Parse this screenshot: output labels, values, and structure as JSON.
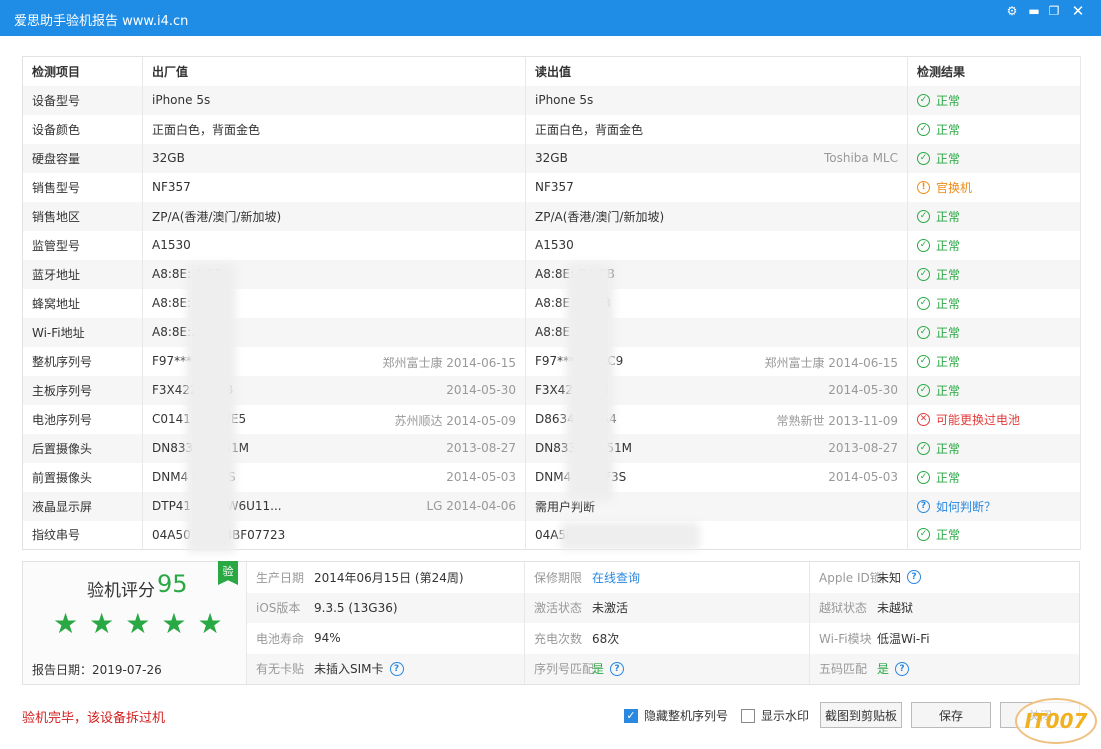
{
  "window": {
    "title": "爱思助手验机报告 www.i4.cn",
    "controls": [
      "settings-icon",
      "minimize-icon",
      "restore-icon",
      "close-icon"
    ]
  },
  "table": {
    "headers": [
      "检测项目",
      "出厂值",
      "读出值",
      "检测结果"
    ],
    "rows": [
      {
        "item": "设备型号",
        "factory": "iPhone 5s",
        "factory_note": "",
        "read": "iPhone 5s",
        "read_note": "",
        "result": "正常",
        "status": "ok"
      },
      {
        "item": "设备颜色",
        "factory": "正面白色，背面金色",
        "factory_note": "",
        "read": "正面白色，背面金色",
        "read_note": "",
        "result": "正常",
        "status": "ok"
      },
      {
        "item": "硬盘容量",
        "factory": "32GB",
        "factory_note": "",
        "read": "32GB",
        "read_note": "Toshiba MLC",
        "result": "正常",
        "status": "ok"
      },
      {
        "item": "销售型号",
        "factory": "NF357",
        "factory_note": "",
        "read": "NF357",
        "read_note": "",
        "result": "官换机",
        "status": "warn"
      },
      {
        "item": "销售地区",
        "factory": "ZP/A(香港/澳门/新加坡)",
        "factory_note": "",
        "read": "ZP/A(香港/澳门/新加坡)",
        "read_note": "",
        "result": "正常",
        "status": "ok"
      },
      {
        "item": "监管型号",
        "factory": "A1530",
        "factory_note": "",
        "read": "A1530",
        "read_note": "",
        "result": "正常",
        "status": "ok"
      },
      {
        "item": "蓝牙地址",
        "factory": "A8:8E:          A:9B",
        "factory_note": "",
        "read": "A8:8E:          DA:9B",
        "read_note": "",
        "result": "正常",
        "status": "ok"
      },
      {
        "item": "蜂窝地址",
        "factory": "A8:8E:           3B",
        "factory_note": "",
        "read": "A8:8E           DA:3B",
        "read_note": "",
        "result": "正常",
        "status": "ok"
      },
      {
        "item": "Wi-Fi地址",
        "factory": "A8:8E:2          9A",
        "factory_note": "",
        "read": "A8:8E           D:9A",
        "read_note": "",
        "result": "正常",
        "status": "ok"
      },
      {
        "item": "整机序列号",
        "factory": "F97****",
        "factory_note": "郑州富士康 2014-06-15",
        "read": "F97******FKC9",
        "read_note": "郑州富士康 2014-06-15",
        "result": "正常",
        "status": "ok"
      },
      {
        "item": "主板序列号",
        "factory": "F3X422         7V2B",
        "factory_note": "2014-05-30",
        "read": "F3X42           7V2B",
        "read_note": "2014-05-30",
        "result": "正常",
        "status": "ok"
      },
      {
        "item": "电池序列号",
        "factory": "C0141          FHCWE5",
        "factory_note": "苏州顺达 2014-05-09",
        "read": "D8634          HFYA4",
        "read_note": "常熟新世 2013-11-09",
        "result": "可能更换过电池",
        "status": "bad"
      },
      {
        "item": "后置摄像头",
        "factory": "DN833          F4W51M",
        "factory_note": "2013-08-27",
        "read": "DN833          F4W51M",
        "read_note": "2013-08-27",
        "result": "正常",
        "status": "ok"
      },
      {
        "item": "前置摄像头",
        "factory": "DNM4           FLKF3S",
        "factory_note": "2014-05-03",
        "read": "DNM4           7FLKF3S",
        "read_note": "2014-05-03",
        "result": "正常",
        "status": "ok"
      },
      {
        "item": "液晶显示屏",
        "factory": "DTP41         A11XW6U11...",
        "factory_note": "LG 2014-04-06",
        "read": "需用户判断",
        "read_note": "",
        "result": "如何判断？",
        "status": "info"
      },
      {
        "item": "指纹串号",
        "factory": "04A50          2FAC8BF07723",
        "factory_note": "",
        "read": "04A504          C8BF07723",
        "read_note": "",
        "result": "正常",
        "status": "ok"
      }
    ]
  },
  "summary": {
    "score_label": "验机评分",
    "score": "95",
    "stars": 5,
    "badge": "验",
    "report_date": "报告日期：2019-07-26",
    "cells": [
      {
        "key": "生产日期",
        "value": "2014年06月15日 (第24周)",
        "style": "",
        "help": false
      },
      {
        "key": "保修期限",
        "value": "在线查询",
        "style": "link",
        "help": false
      },
      {
        "key": "Apple ID锁",
        "value": "未知",
        "style": "",
        "help": true
      },
      {
        "key": "iOS版本",
        "value": "9.3.5 (13G36)",
        "style": "",
        "help": false
      },
      {
        "key": "激活状态",
        "value": "未激活",
        "style": "",
        "help": false
      },
      {
        "key": "越狱状态",
        "value": "未越狱",
        "style": "",
        "help": false
      },
      {
        "key": "电池寿命",
        "value": "94%",
        "style": "",
        "help": false
      },
      {
        "key": "充电次数",
        "value": "68次",
        "style": "",
        "help": false
      },
      {
        "key": "Wi-Fi模块",
        "value": "低温Wi-Fi",
        "style": "",
        "help": false
      },
      {
        "key": "有无卡贴",
        "value": "未插入SIM卡",
        "style": "",
        "help": true
      },
      {
        "key": "序列号匹配",
        "value": "是",
        "style": "green",
        "help": true
      },
      {
        "key": "五码匹配",
        "value": "是",
        "style": "green",
        "help": true
      }
    ]
  },
  "footer": {
    "message": "验机完毕，该设备拆过机",
    "hide_serial_label": "隐藏整机序列号",
    "hide_serial_checked": true,
    "watermark_label": "显示水印",
    "watermark_checked": false,
    "copy_button": "截图到剪贴板",
    "save_button": "保存",
    "close_button": "关闭",
    "logo_text": "IT007"
  },
  "colors": {
    "titlebar": "#1f8ce6",
    "ok": "#2aa844",
    "warn": "#ef8b17",
    "bad": "#e23b3b",
    "info": "#2a88e0"
  }
}
